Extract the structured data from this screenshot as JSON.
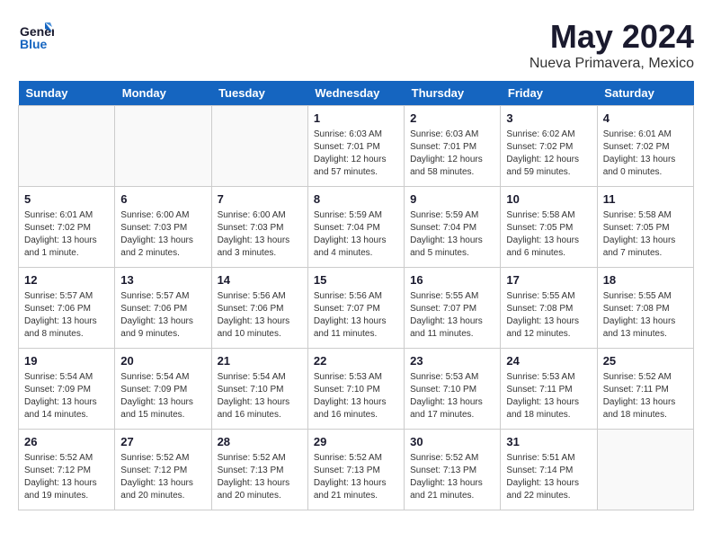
{
  "header": {
    "logo_line1": "General",
    "logo_line2": "Blue",
    "month_title": "May 2024",
    "location": "Nueva Primavera, Mexico"
  },
  "days_of_week": [
    "Sunday",
    "Monday",
    "Tuesday",
    "Wednesday",
    "Thursday",
    "Friday",
    "Saturday"
  ],
  "weeks": [
    [
      {
        "day": "",
        "info": ""
      },
      {
        "day": "",
        "info": ""
      },
      {
        "day": "",
        "info": ""
      },
      {
        "day": "1",
        "info": "Sunrise: 6:03 AM\nSunset: 7:01 PM\nDaylight: 12 hours\nand 57 minutes."
      },
      {
        "day": "2",
        "info": "Sunrise: 6:03 AM\nSunset: 7:01 PM\nDaylight: 12 hours\nand 58 minutes."
      },
      {
        "day": "3",
        "info": "Sunrise: 6:02 AM\nSunset: 7:02 PM\nDaylight: 12 hours\nand 59 minutes."
      },
      {
        "day": "4",
        "info": "Sunrise: 6:01 AM\nSunset: 7:02 PM\nDaylight: 13 hours\nand 0 minutes."
      }
    ],
    [
      {
        "day": "5",
        "info": "Sunrise: 6:01 AM\nSunset: 7:02 PM\nDaylight: 13 hours\nand 1 minute."
      },
      {
        "day": "6",
        "info": "Sunrise: 6:00 AM\nSunset: 7:03 PM\nDaylight: 13 hours\nand 2 minutes."
      },
      {
        "day": "7",
        "info": "Sunrise: 6:00 AM\nSunset: 7:03 PM\nDaylight: 13 hours\nand 3 minutes."
      },
      {
        "day": "8",
        "info": "Sunrise: 5:59 AM\nSunset: 7:04 PM\nDaylight: 13 hours\nand 4 minutes."
      },
      {
        "day": "9",
        "info": "Sunrise: 5:59 AM\nSunset: 7:04 PM\nDaylight: 13 hours\nand 5 minutes."
      },
      {
        "day": "10",
        "info": "Sunrise: 5:58 AM\nSunset: 7:05 PM\nDaylight: 13 hours\nand 6 minutes."
      },
      {
        "day": "11",
        "info": "Sunrise: 5:58 AM\nSunset: 7:05 PM\nDaylight: 13 hours\nand 7 minutes."
      }
    ],
    [
      {
        "day": "12",
        "info": "Sunrise: 5:57 AM\nSunset: 7:06 PM\nDaylight: 13 hours\nand 8 minutes."
      },
      {
        "day": "13",
        "info": "Sunrise: 5:57 AM\nSunset: 7:06 PM\nDaylight: 13 hours\nand 9 minutes."
      },
      {
        "day": "14",
        "info": "Sunrise: 5:56 AM\nSunset: 7:06 PM\nDaylight: 13 hours\nand 10 minutes."
      },
      {
        "day": "15",
        "info": "Sunrise: 5:56 AM\nSunset: 7:07 PM\nDaylight: 13 hours\nand 11 minutes."
      },
      {
        "day": "16",
        "info": "Sunrise: 5:55 AM\nSunset: 7:07 PM\nDaylight: 13 hours\nand 11 minutes."
      },
      {
        "day": "17",
        "info": "Sunrise: 5:55 AM\nSunset: 7:08 PM\nDaylight: 13 hours\nand 12 minutes."
      },
      {
        "day": "18",
        "info": "Sunrise: 5:55 AM\nSunset: 7:08 PM\nDaylight: 13 hours\nand 13 minutes."
      }
    ],
    [
      {
        "day": "19",
        "info": "Sunrise: 5:54 AM\nSunset: 7:09 PM\nDaylight: 13 hours\nand 14 minutes."
      },
      {
        "day": "20",
        "info": "Sunrise: 5:54 AM\nSunset: 7:09 PM\nDaylight: 13 hours\nand 15 minutes."
      },
      {
        "day": "21",
        "info": "Sunrise: 5:54 AM\nSunset: 7:10 PM\nDaylight: 13 hours\nand 16 minutes."
      },
      {
        "day": "22",
        "info": "Sunrise: 5:53 AM\nSunset: 7:10 PM\nDaylight: 13 hours\nand 16 minutes."
      },
      {
        "day": "23",
        "info": "Sunrise: 5:53 AM\nSunset: 7:10 PM\nDaylight: 13 hours\nand 17 minutes."
      },
      {
        "day": "24",
        "info": "Sunrise: 5:53 AM\nSunset: 7:11 PM\nDaylight: 13 hours\nand 18 minutes."
      },
      {
        "day": "25",
        "info": "Sunrise: 5:52 AM\nSunset: 7:11 PM\nDaylight: 13 hours\nand 18 minutes."
      }
    ],
    [
      {
        "day": "26",
        "info": "Sunrise: 5:52 AM\nSunset: 7:12 PM\nDaylight: 13 hours\nand 19 minutes."
      },
      {
        "day": "27",
        "info": "Sunrise: 5:52 AM\nSunset: 7:12 PM\nDaylight: 13 hours\nand 20 minutes."
      },
      {
        "day": "28",
        "info": "Sunrise: 5:52 AM\nSunset: 7:13 PM\nDaylight: 13 hours\nand 20 minutes."
      },
      {
        "day": "29",
        "info": "Sunrise: 5:52 AM\nSunset: 7:13 PM\nDaylight: 13 hours\nand 21 minutes."
      },
      {
        "day": "30",
        "info": "Sunrise: 5:52 AM\nSunset: 7:13 PM\nDaylight: 13 hours\nand 21 minutes."
      },
      {
        "day": "31",
        "info": "Sunrise: 5:51 AM\nSunset: 7:14 PM\nDaylight: 13 hours\nand 22 minutes."
      },
      {
        "day": "",
        "info": ""
      }
    ]
  ]
}
